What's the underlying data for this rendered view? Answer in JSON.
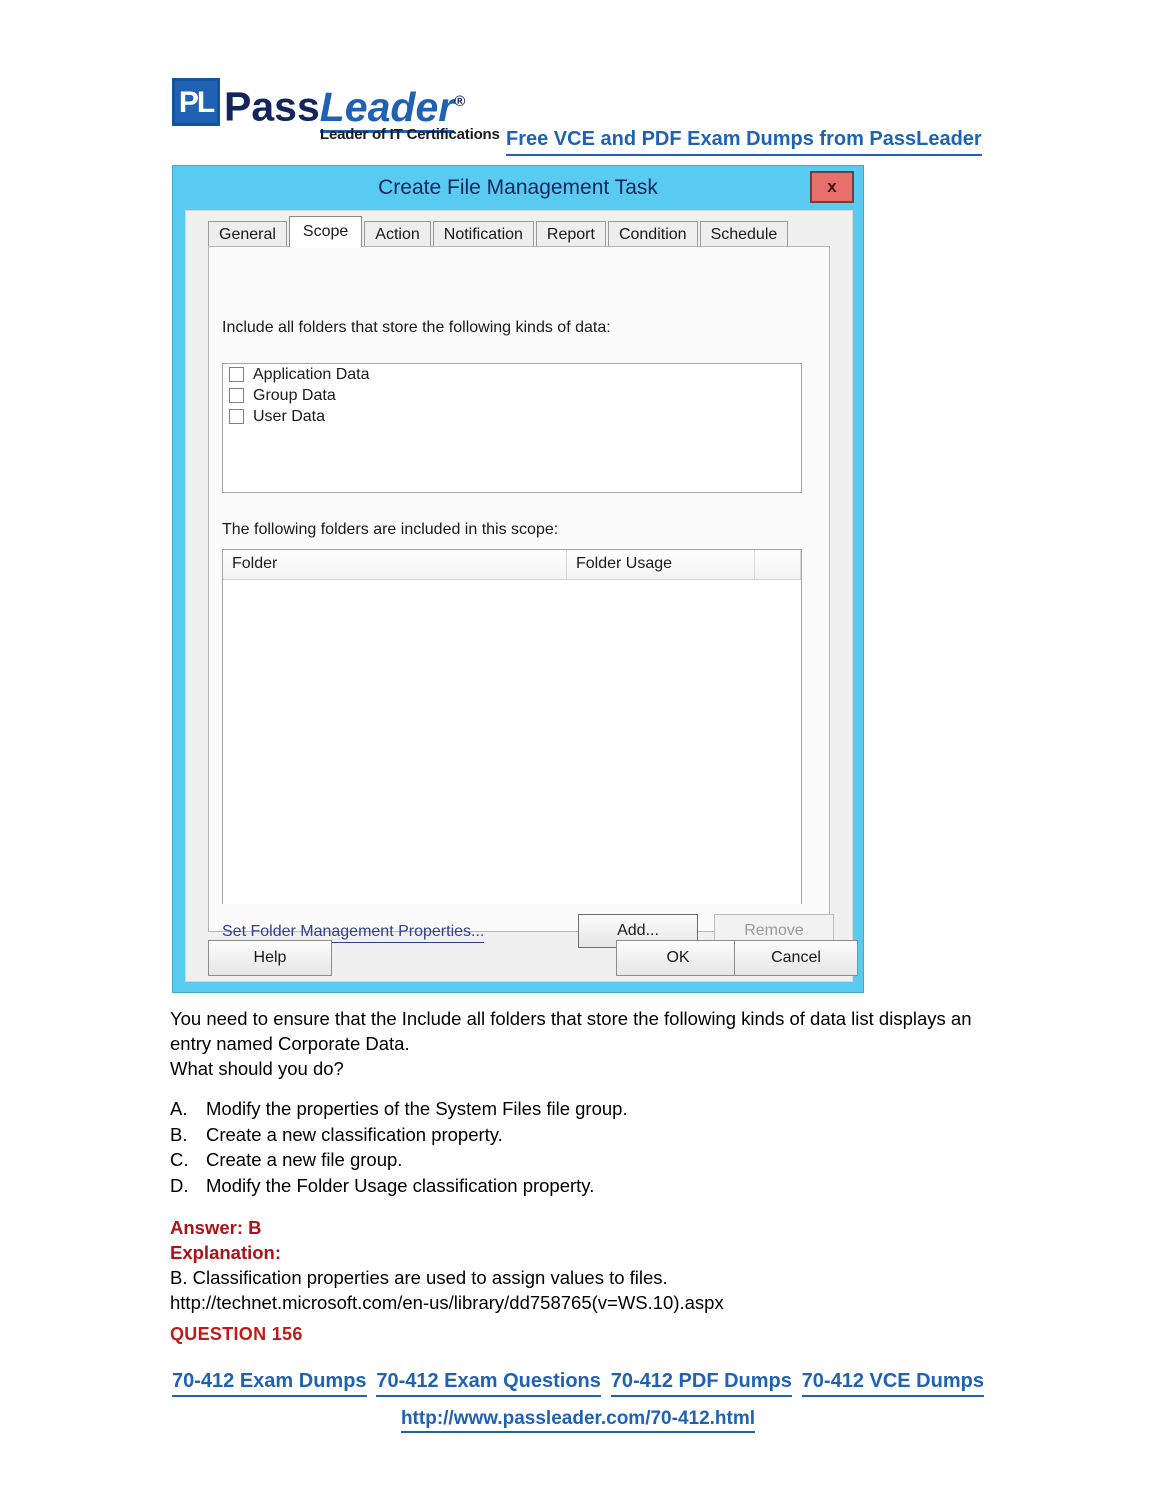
{
  "header": {
    "logo_mark": "PL",
    "logo_pass": "Pass",
    "logo_leader": "Leader",
    "logo_reg": "®",
    "tagline": "Leader of IT Certifications",
    "promo_link": "Free VCE and PDF Exam Dumps from PassLeader"
  },
  "dialog": {
    "title": "Create File Management Task",
    "close_label": "x",
    "accent_color": "#59cbf0",
    "title_color": "#14255e",
    "close_color": "#e8706a",
    "tabs": [
      {
        "label": "General",
        "selected": false
      },
      {
        "label": "Scope",
        "selected": true
      },
      {
        "label": "Action",
        "selected": false
      },
      {
        "label": "Notification",
        "selected": false
      },
      {
        "label": "Report",
        "selected": false
      },
      {
        "label": "Condition",
        "selected": false
      },
      {
        "label": "Schedule",
        "selected": false
      }
    ],
    "scope": {
      "kinds_label": "Include all folders that store the following kinds of data:",
      "kinds": [
        {
          "label": "Application Data",
          "checked": false
        },
        {
          "label": "Group Data",
          "checked": false
        },
        {
          "label": "User Data",
          "checked": false
        }
      ],
      "folders_label": "The following folders are included in this scope:",
      "folders_columns": [
        "Folder",
        "Folder Usage"
      ],
      "folders_rows": [],
      "properties_link": "Set Folder Management Properties...",
      "add_button": "Add...",
      "remove_button": "Remove"
    },
    "footer": {
      "help": "Help",
      "ok": "OK",
      "cancel": "Cancel"
    }
  },
  "question": {
    "stem_line1": "You need to ensure that the Include all folders that store the following kinds of data list displays an",
    "stem_line2": "entry named Corporate Data.",
    "stem_line3": "What should you do?",
    "choices": [
      {
        "letter": "A.",
        "text": "Modify the properties of the System Files file group."
      },
      {
        "letter": "B.",
        "text": "Create a new classification property."
      },
      {
        "letter": "C.",
        "text": "Create a new file group."
      },
      {
        "letter": "D.",
        "text": "Modify the Folder Usage classification property."
      }
    ],
    "answer_label": "Answer:",
    "answer_value": "B",
    "explanation_label": "Explanation:",
    "explanation_text": "B. Classification properties are used to assign values to files.",
    "explanation_url": "http://technet.microsoft.com/en-us/library/dd758765(v=WS.10).aspx",
    "next_question": "QUESTION 156"
  },
  "footer": {
    "links": [
      "70-412 Exam Dumps",
      "70-412 Exam Questions",
      "70-412 PDF Dumps",
      "70-412 VCE Dumps"
    ],
    "url": "http://www.passleader.com/70-412.html"
  }
}
